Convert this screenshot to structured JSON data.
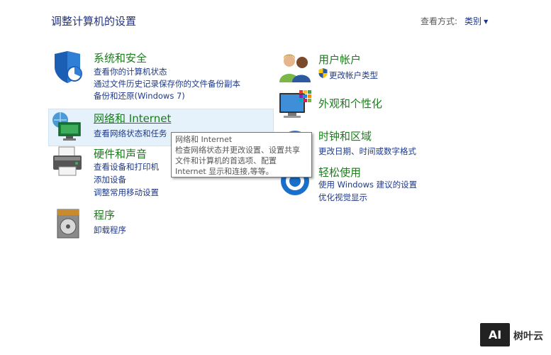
{
  "page_title": "调整计算机的设置",
  "view_by": {
    "label": "查看方式:",
    "value": "类别"
  },
  "categories": [
    {
      "title": "系统和安全",
      "links": [
        "查看你的计算机状态",
        "通过文件历史记录保存你的文件备份副本",
        "备份和还原(Windows 7)"
      ]
    },
    {
      "title": "网络和 Internet",
      "links": [
        "查看网络状态和任务"
      ]
    },
    {
      "title": "硬件和声音",
      "links": [
        "查看设备和打印机",
        "添加设备",
        "调整常用移动设置"
      ]
    },
    {
      "title": "程序",
      "links": [
        "卸载程序"
      ]
    },
    {
      "title": "用户帐户",
      "links": [
        "更改帐户类型"
      ]
    },
    {
      "title": "外观和个性化",
      "links": []
    },
    {
      "title": "时钟和区域",
      "links": [
        "更改日期、时间或数字格式"
      ]
    },
    {
      "title": "轻松使用",
      "links": [
        "使用 Windows 建议的设置",
        "优化视觉显示"
      ]
    }
  ],
  "tooltip": {
    "lines": [
      "网络和 Internet",
      "检查网络状态并更改设置、设置共享",
      "文件和计算机的首选项、配置",
      "Internet 显示和连接,等等。"
    ]
  },
  "watermark": {
    "logo": "AI",
    "text": "树叶云"
  },
  "colors": {
    "title_blue": "#1e3287",
    "category_green": "#1a7c1a",
    "link_blue": "#1e3a8a",
    "hover_bg": "#e5f1fb"
  }
}
